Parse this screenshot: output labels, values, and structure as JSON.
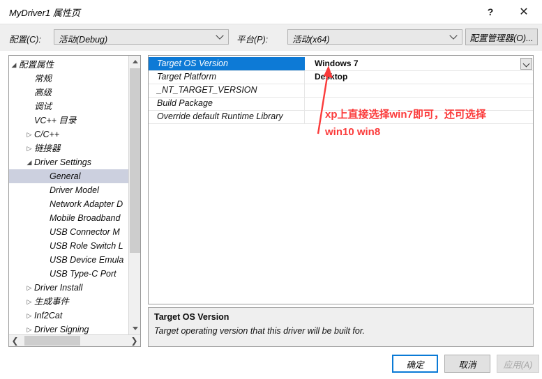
{
  "window": {
    "title": "MyDriver1 属性页",
    "help_icon": "question-mark-icon",
    "close_icon": "close-icon"
  },
  "configbar": {
    "config_label": "配置(C):",
    "config_value": "活动(Debug)",
    "platform_label": "平台(P):",
    "platform_value": "活动(x64)",
    "config_manager_button": "配置管理器(O)..."
  },
  "tree": {
    "items": [
      {
        "label": "配置属性",
        "indent": 0,
        "twisty": "expanded"
      },
      {
        "label": "常规",
        "indent": 1,
        "twisty": "none"
      },
      {
        "label": "高级",
        "indent": 1,
        "twisty": "none"
      },
      {
        "label": "调试",
        "indent": 1,
        "twisty": "none"
      },
      {
        "label": "VC++ 目录",
        "indent": 1,
        "twisty": "none"
      },
      {
        "label": "C/C++",
        "indent": 1,
        "twisty": "collapsed"
      },
      {
        "label": "链接器",
        "indent": 1,
        "twisty": "collapsed"
      },
      {
        "label": "Driver Settings",
        "indent": 1,
        "twisty": "expanded"
      },
      {
        "label": "General",
        "indent": 2,
        "twisty": "none",
        "selected": true
      },
      {
        "label": "Driver Model",
        "indent": 2,
        "twisty": "none"
      },
      {
        "label": "Network Adapter D",
        "indent": 2,
        "twisty": "none"
      },
      {
        "label": "Mobile Broadband",
        "indent": 2,
        "twisty": "none"
      },
      {
        "label": "USB Connector M",
        "indent": 2,
        "twisty": "none"
      },
      {
        "label": "USB Role Switch L",
        "indent": 2,
        "twisty": "none"
      },
      {
        "label": "USB Device Emula",
        "indent": 2,
        "twisty": "none"
      },
      {
        "label": "USB Type-C Port",
        "indent": 2,
        "twisty": "none"
      },
      {
        "label": "Driver Install",
        "indent": 1,
        "twisty": "collapsed"
      },
      {
        "label": "生成事件",
        "indent": 1,
        "twisty": "collapsed"
      },
      {
        "label": "Inf2Cat",
        "indent": 1,
        "twisty": "collapsed"
      },
      {
        "label": "Driver Signing",
        "indent": 1,
        "twisty": "collapsed"
      }
    ]
  },
  "grid": {
    "rows": [
      {
        "name": "Target OS Version",
        "value": "Windows 7",
        "selected": true,
        "has_dropdown": true
      },
      {
        "name": "Target Platform",
        "value": "Desktop"
      },
      {
        "name": "_NT_TARGET_VERSION",
        "value": ""
      },
      {
        "name": "Build Package",
        "value": ""
      },
      {
        "name": "Override default Runtime Library",
        "value": ""
      }
    ]
  },
  "annotation": {
    "text": "xp上直接选择win7即可，还可选择\nwin10 win8",
    "color": "#fb3b3b"
  },
  "description": {
    "title": "Target OS Version",
    "body": "Target operating version that this driver will be built for."
  },
  "footer": {
    "ok": "确定",
    "cancel": "取消",
    "apply": "应用(A)"
  }
}
